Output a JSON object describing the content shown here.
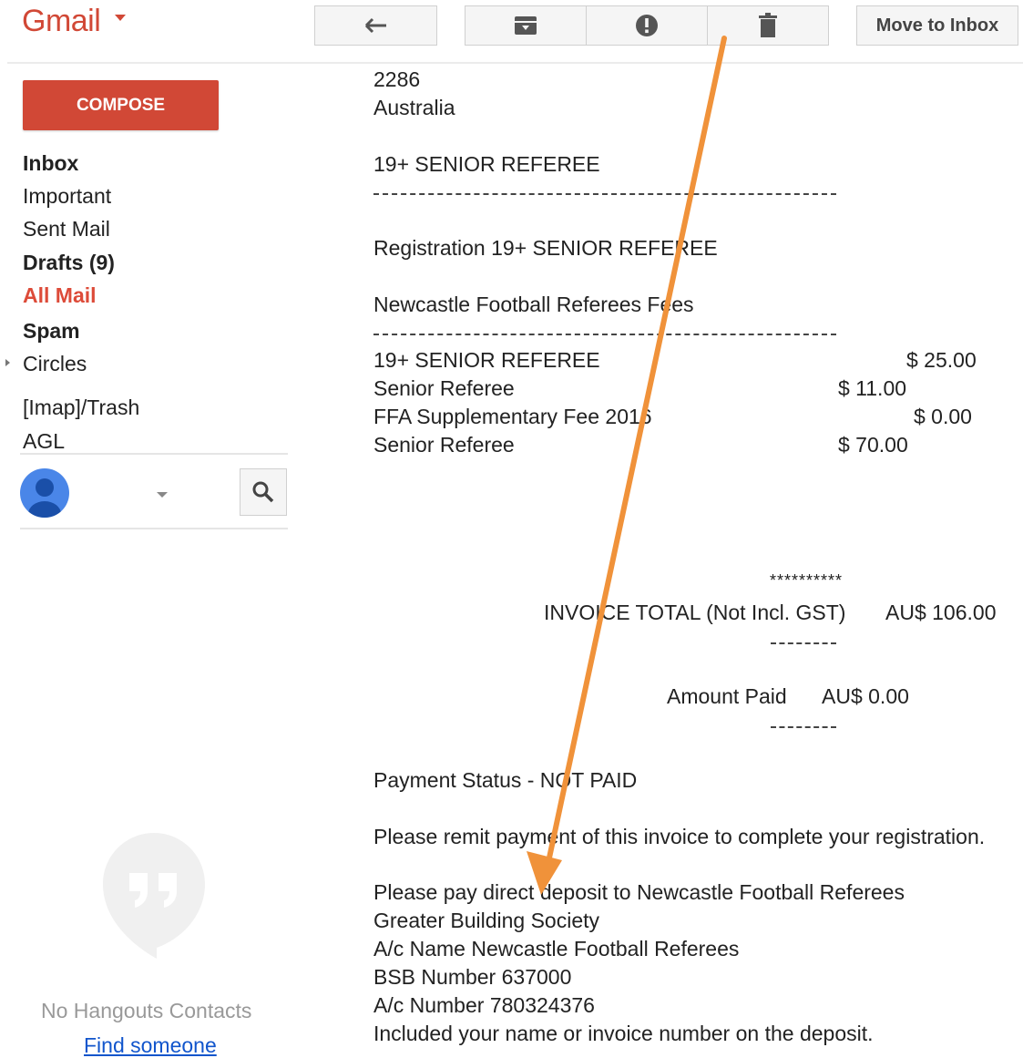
{
  "header": {
    "logo": "Gmail",
    "move_to_inbox_label": "Move to Inbox"
  },
  "sidebar": {
    "compose_label": "COMPOSE",
    "items": [
      {
        "label": "Inbox"
      },
      {
        "label": "Important"
      },
      {
        "label": "Sent Mail"
      },
      {
        "label": "Drafts (9)"
      },
      {
        "label": "All Mail"
      },
      {
        "label": "Spam"
      },
      {
        "label": "Circles"
      },
      {
        "label": "[Imap]/Trash"
      },
      {
        "label": "AGL"
      }
    ],
    "hangouts": {
      "empty_text": "No Hangouts Contacts",
      "find_link": "Find someone"
    }
  },
  "email": {
    "postcode": "2286",
    "country": "Australia",
    "category_heading": "19+ SENIOR REFEREE",
    "registration_line": "Registration 19+ SENIOR REFEREE",
    "fees_heading": "Newcastle Football Referees Fees",
    "line_items": [
      {
        "desc": "19+ SENIOR REFEREE",
        "amount": "$ 25.00"
      },
      {
        "desc": "Senior Referee",
        "amount": "$ 11.00"
      },
      {
        "desc": "FFA Supplementary Fee 2016",
        "amount": "$ 0.00"
      },
      {
        "desc": "Senior Referee",
        "amount": "$ 70.00"
      }
    ],
    "stars": "**********",
    "invoice_total_label": "INVOICE TOTAL (Not Incl. GST)",
    "invoice_total_value": "AU$ 106.00",
    "amount_paid_label": "Amount Paid",
    "amount_paid_value": "AU$ 0.00",
    "payment_status": "Payment Status - NOT PAID",
    "remit_text": "Please remit payment of this invoice to complete your registration.",
    "deposit_lines": [
      "Please pay direct deposit to Newcastle Football Referees",
      "Greater Building Society",
      "A/c Name Newcastle Football Referees",
      "BSB Number 637000",
      "A/c Number 780324376",
      "Included your name or invoice number on the deposit."
    ]
  },
  "colors": {
    "brand_red": "#d14836",
    "annotation_arrow": "#f0923a"
  }
}
